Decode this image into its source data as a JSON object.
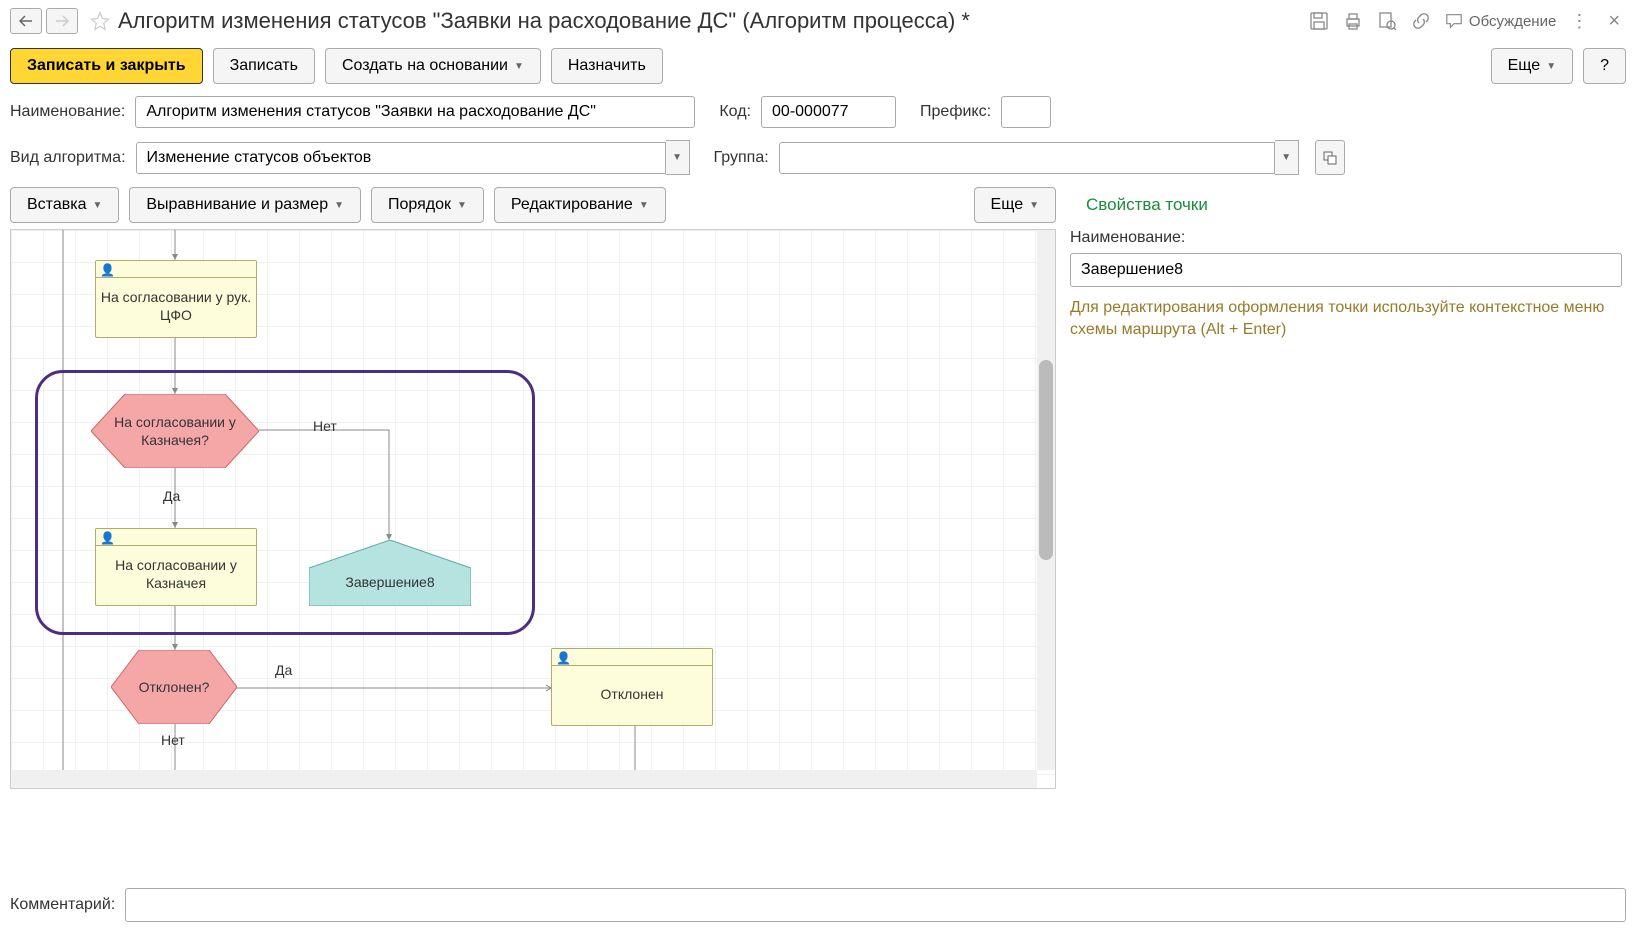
{
  "header": {
    "title": "Алгоритм изменения статусов \"Заявки на расходование ДС\" (Алгоритм процесса) *",
    "discuss": "Обсуждение"
  },
  "toolbar": {
    "save_close": "Записать и закрыть",
    "save": "Записать",
    "create_from": "Создать на основании",
    "assign": "Назначить",
    "more": "Еще",
    "help": "?"
  },
  "form": {
    "name_label": "Наименование:",
    "name_value": "Алгоритм изменения статусов \"Заявки на расходование ДС\"",
    "code_label": "Код:",
    "code_value": "00-000077",
    "prefix_label": "Префикс:",
    "prefix_value": "",
    "algo_type_label": "Вид алгоритма:",
    "algo_type_value": "Изменение статусов объектов",
    "group_label": "Группа:",
    "group_value": ""
  },
  "canvas_toolbar": {
    "insert": "Вставка",
    "align": "Выравнивание и размер",
    "order": "Порядок",
    "edit": "Редактирование",
    "more": "Еще"
  },
  "flowchart": {
    "node_approval_cfo": "На согласовании у рук. ЦФО",
    "node_treasurer_q": "На согласовании у Казначея?",
    "node_treasurer": "На согласовании у Казначея",
    "node_end8": "Завершение8",
    "node_rejected_q": "Отклонен?",
    "node_rejected": "Отклонен",
    "label_no": "Нет",
    "label_yes": "Да"
  },
  "side": {
    "title": "Свойства точки",
    "name_label": "Наименование:",
    "name_value": "Завершение8",
    "hint": "Для редактирования оформления точки используйте контекстное меню схемы маршрута (Alt + Enter)"
  },
  "comment": {
    "label": "Комментарий:",
    "value": ""
  }
}
